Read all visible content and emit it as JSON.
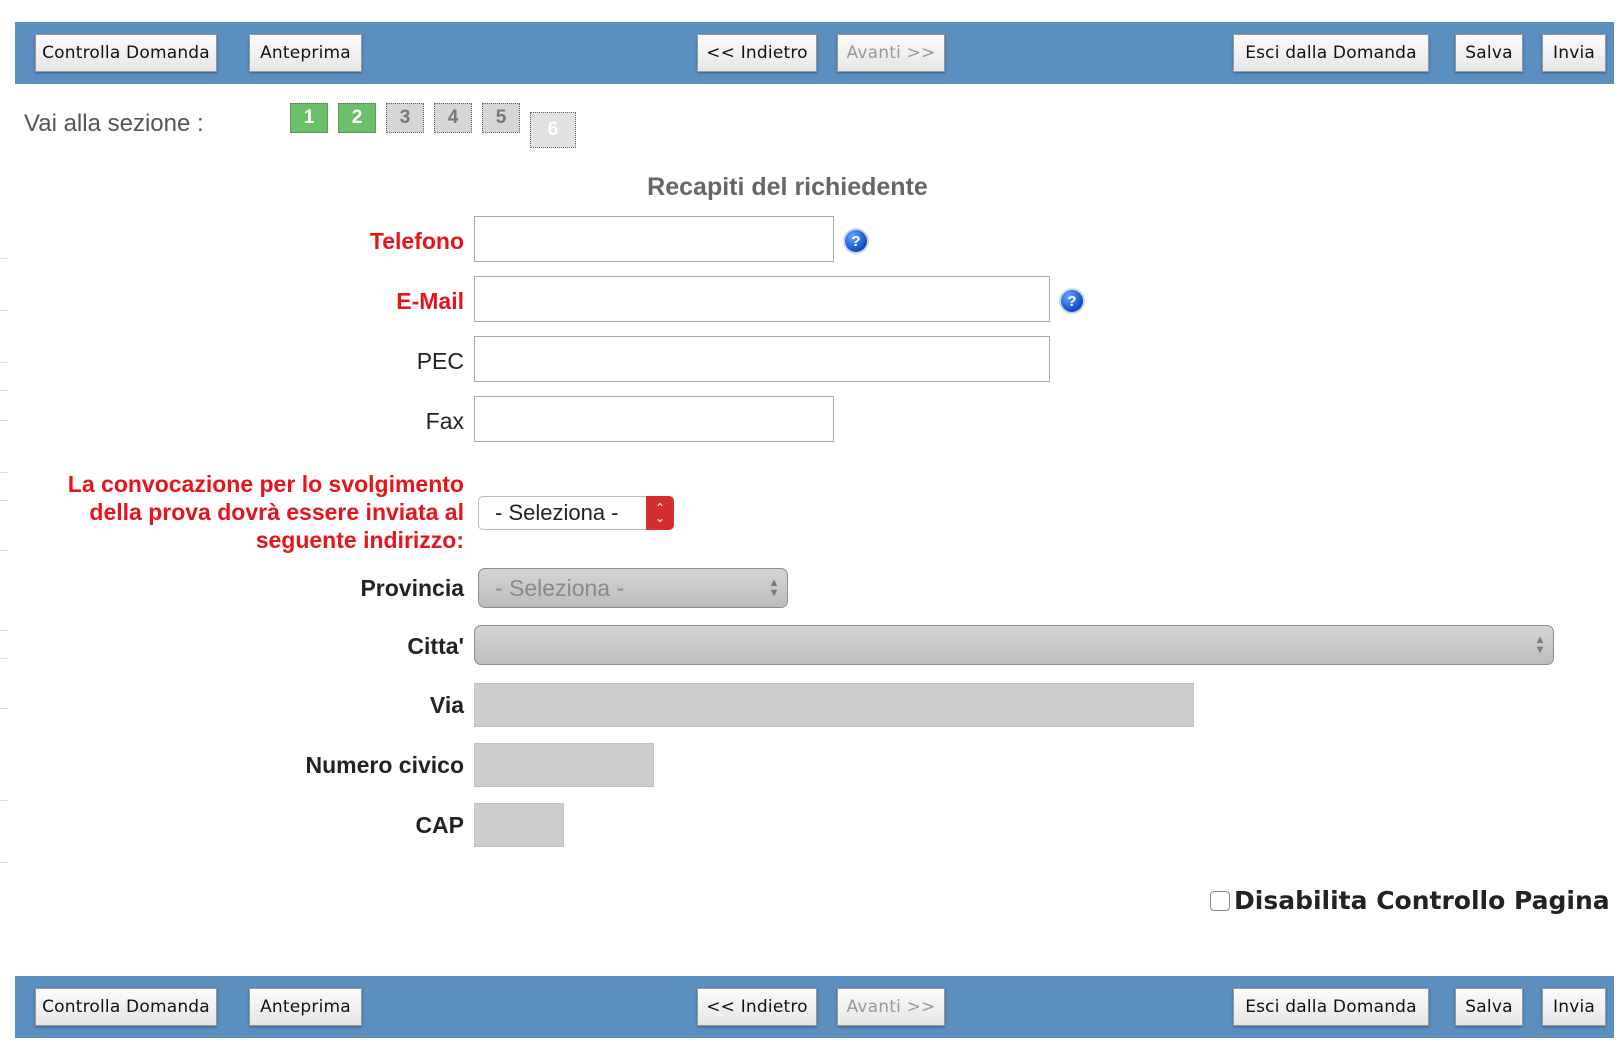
{
  "toolbar": {
    "controlla_label": "Controlla Domanda",
    "anteprima_label": "Anteprima",
    "indietro_label": "<< Indietro",
    "avanti_label": "Avanti >>",
    "esci_label": "Esci dalla Domanda",
    "salva_label": "Salva",
    "invia_label": "Invia"
  },
  "sections": {
    "label": "Vai alla sezione :",
    "items": [
      {
        "num": "1",
        "state": "done"
      },
      {
        "num": "2",
        "state": "done"
      },
      {
        "num": "3",
        "state": "todo"
      },
      {
        "num": "4",
        "state": "todo"
      },
      {
        "num": "5",
        "state": "todo"
      },
      {
        "num": "6",
        "state": "future"
      }
    ]
  },
  "form": {
    "title": "Recapiti del richiedente",
    "telefono": {
      "label": "Telefono",
      "value": ""
    },
    "email": {
      "label": "E-Mail",
      "value": ""
    },
    "pec": {
      "label": "PEC",
      "value": ""
    },
    "fax": {
      "label": "Fax",
      "value": ""
    },
    "convocazione": {
      "label": "La convocazione per lo svolgimento della prova dovrà essere inviata al seguente indirizzo:",
      "selected": "- Seleziona -"
    },
    "provincia": {
      "label": "Provincia",
      "selected": "- Seleziona -"
    },
    "citta": {
      "label": "Citta'",
      "selected": ""
    },
    "via": {
      "label": "Via",
      "value": ""
    },
    "numero_civico": {
      "label": "Numero civico",
      "value": ""
    },
    "cap": {
      "label": "CAP",
      "value": ""
    },
    "help_glyph": "?",
    "help_icon": "help-icon"
  },
  "disable_check": {
    "label": "Disabilita Controllo Pagina",
    "checked": false
  },
  "colors": {
    "toolbar_bg": "#5a8fbf",
    "required_label": "#e8141c",
    "section_done": "#6abf69",
    "select_arrow": "#d32f2f"
  }
}
